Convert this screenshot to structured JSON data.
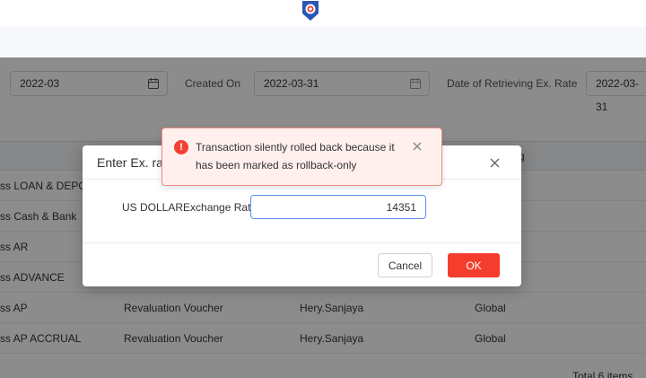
{
  "filters": {
    "period_value": "2022-03",
    "created_on_label": "Created On",
    "created_on_value": "2022-03-31",
    "retrieval_label": "Date of Retrieving Ex. Rate",
    "retrieval_value": "2022-03-31"
  },
  "table": {
    "header_last": "g",
    "rows": [
      {
        "name": "ss LOAN & DEPOS",
        "type": "",
        "user": "",
        "scope": ""
      },
      {
        "name": "ss Cash & Bank",
        "type": "",
        "user": "",
        "scope": ""
      },
      {
        "name": "ss AR",
        "type": "",
        "user": "",
        "scope": ""
      },
      {
        "name": "ss ADVANCE",
        "type": "",
        "user": "",
        "scope": ""
      },
      {
        "name": "ss AP",
        "type": "Revaluation Voucher",
        "user": "Hery.Sanjaya",
        "scope": "Global"
      },
      {
        "name": "ss AP ACCRUAL",
        "type": "Revaluation Voucher",
        "user": "Hery.Sanjaya",
        "scope": "Global"
      }
    ],
    "footer": "Total 6 items"
  },
  "modal": {
    "title": "Enter Ex. rate",
    "rate_label": "US DOLLARExchange Rate",
    "rate_value": "14351",
    "cancel_label": "Cancel",
    "ok_label": "OK"
  },
  "toast": {
    "icon": "!",
    "message": "Transaction silently rolled back because it has been marked as rollback-only"
  },
  "colors": {
    "primary_red": "#f53d2d",
    "error_bg": "#fff0ee",
    "focus_blue": "#5b8def"
  }
}
